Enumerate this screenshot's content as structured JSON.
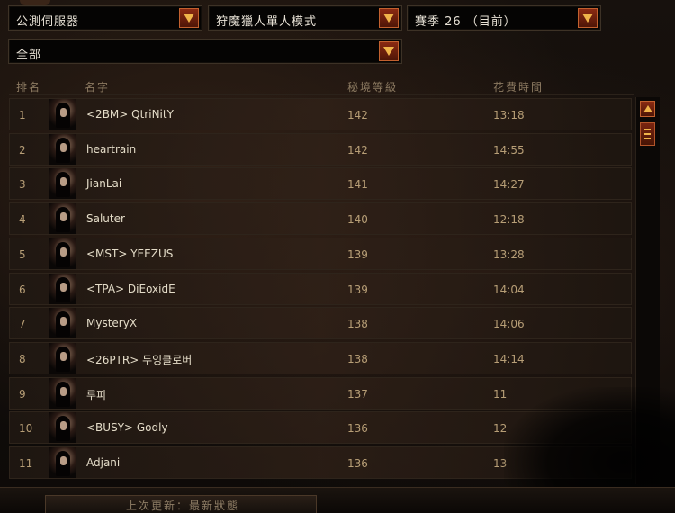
{
  "filters": {
    "server": "公測伺服器",
    "mode": "狩魔獵人單人模式",
    "season": "賽季 26 （目前）",
    "scope": "全部"
  },
  "columns": {
    "rank": "排名",
    "name": "名字",
    "level": "秘境等級",
    "time": "花費時間"
  },
  "rows": [
    {
      "rank": "1",
      "name": "<2BM> QtriNitY",
      "level": "142",
      "time": "13:18"
    },
    {
      "rank": "2",
      "name": "heartrain",
      "level": "142",
      "time": "14:55"
    },
    {
      "rank": "3",
      "name": "JianLai",
      "level": "141",
      "time": "14:27"
    },
    {
      "rank": "4",
      "name": "Saluter",
      "level": "140",
      "time": "12:18"
    },
    {
      "rank": "5",
      "name": "<MST> YEEZUS",
      "level": "139",
      "time": "13:28"
    },
    {
      "rank": "6",
      "name": "<TPA> DiEoxidE",
      "level": "139",
      "time": "14:04"
    },
    {
      "rank": "7",
      "name": "MysteryX",
      "level": "138",
      "time": "14:06"
    },
    {
      "rank": "8",
      "name": "<26PTR> 두잉클로버",
      "level": "138",
      "time": "14:14"
    },
    {
      "rank": "9",
      "name": "루피",
      "level": "137",
      "time": "11"
    },
    {
      "rank": "10",
      "name": "<BUSY> Godly",
      "level": "136",
      "time": "12"
    },
    {
      "rank": "11",
      "name": "Adjani",
      "level": "136",
      "time": "13"
    }
  ],
  "footer": {
    "last_update": "上次更新：最新狀態"
  },
  "colors": {
    "accent_button": "#8a2a12",
    "arrow": "#f0b44a",
    "text_values": "#b79e76"
  }
}
